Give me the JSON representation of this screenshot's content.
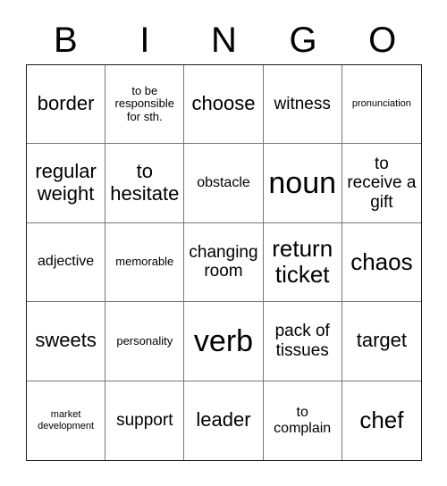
{
  "card": {
    "title": "BINGO",
    "header_letters": [
      "B",
      "I",
      "N",
      "G",
      "O"
    ],
    "colors": {
      "background": "#ffffff",
      "text": "#000000",
      "outer_border": "#1a1a1a",
      "grid_line": "#777777"
    },
    "grid": {
      "rows": 5,
      "columns": 5,
      "cells": [
        {
          "text": "border",
          "size": "xl"
        },
        {
          "text": "to be responsible for sth.",
          "size": "s"
        },
        {
          "text": "choose",
          "size": "xl"
        },
        {
          "text": "witness",
          "size": "l"
        },
        {
          "text": "pronunciation",
          "size": "xs"
        },
        {
          "text": "regular weight",
          "size": "xl"
        },
        {
          "text": "to hesitate",
          "size": "xl"
        },
        {
          "text": "obstacle",
          "size": "m"
        },
        {
          "text": "noun",
          "size": "huge"
        },
        {
          "text": "to receive a gift",
          "size": "l"
        },
        {
          "text": "adjective",
          "size": "m"
        },
        {
          "text": "memorable",
          "size": "s"
        },
        {
          "text": "changing room",
          "size": "l"
        },
        {
          "text": "return ticket",
          "size": "xxl"
        },
        {
          "text": "chaos",
          "size": "xxl"
        },
        {
          "text": "sweets",
          "size": "xl"
        },
        {
          "text": "personality",
          "size": "s"
        },
        {
          "text": "verb",
          "size": "huge"
        },
        {
          "text": "pack of tissues",
          "size": "l"
        },
        {
          "text": "target",
          "size": "xl"
        },
        {
          "text": "market development",
          "size": "xs"
        },
        {
          "text": "support",
          "size": "l"
        },
        {
          "text": "leader",
          "size": "xl"
        },
        {
          "text": "to complain",
          "size": "m"
        },
        {
          "text": "chef",
          "size": "xxl"
        }
      ]
    }
  }
}
